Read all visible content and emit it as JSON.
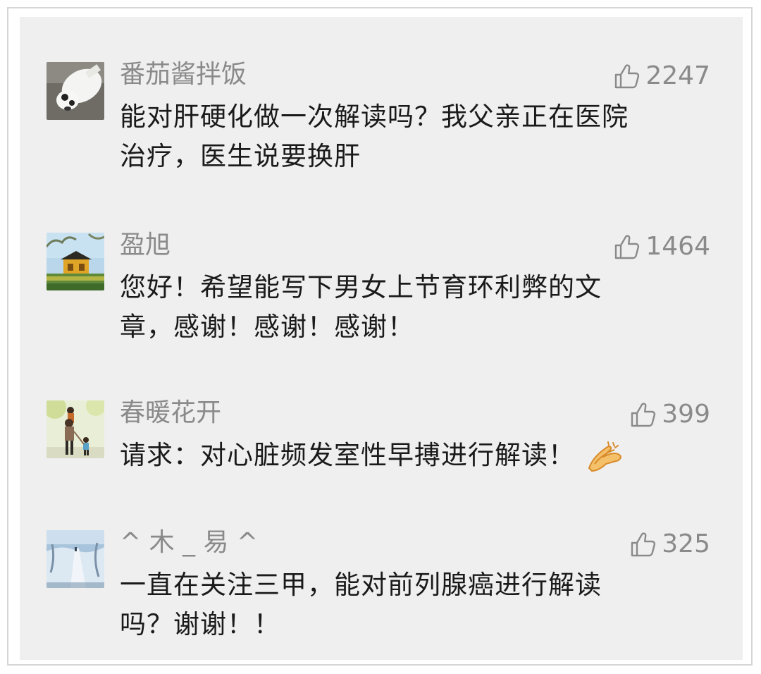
{
  "comments": [
    {
      "user": "番茄酱拌饭",
      "likes": "2247",
      "text": "能对肝硬化做一次解读吗？我父亲正在医院\n治疗，医生说要换肝",
      "avatar_icon": "dog-photo-avatar"
    },
    {
      "user": "盈旭",
      "likes": "1464",
      "text": "您好！希望能写下男女上节育环利弊的文\n章，感谢！感谢！感谢！",
      "avatar_icon": "pavilion-photo-avatar"
    },
    {
      "user": "春暖花开",
      "likes": "399",
      "text": "请求：对心脏频发室性早搏进行解读！",
      "emoji": "clapping-hands-emoji",
      "avatar_icon": "father-child-photo-avatar"
    },
    {
      "user": "^ 木 _ 易 ^",
      "likes": "325",
      "text": "一直在关注三甲，能对前列腺癌进行解读\n吗？谢谢！！",
      "avatar_icon": "snowy-path-photo-avatar"
    }
  ],
  "colors": {
    "background": "#efefef",
    "username": "#8a8a8a",
    "body_text": "#1a1a1a",
    "like": "#8a8a8a"
  }
}
